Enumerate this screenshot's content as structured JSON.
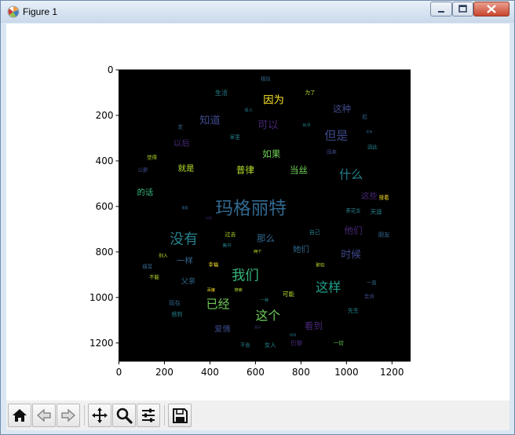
{
  "window": {
    "title": "Figure 1"
  },
  "toolbar": {
    "buttons": [
      "home-icon",
      "back-icon",
      "forward-icon",
      "pan-icon",
      "zoom-icon",
      "configure-subplots-icon",
      "save-icon"
    ]
  },
  "chart_data": {
    "type": "image",
    "description_free": true,
    "x_ticks": [
      "0",
      "200",
      "400",
      "600",
      "800",
      "1000",
      "1200"
    ],
    "y_ticks": [
      "0",
      "200",
      "400",
      "600",
      "800",
      "1000",
      "1200"
    ],
    "xlim": [
      0,
      1280
    ],
    "ylim": [
      1280,
      0
    ],
    "background": "#000000",
    "words": [
      {
        "text": "玛格丽特",
        "x": 580,
        "y": 610,
        "size": 78,
        "color": "#31688e"
      },
      {
        "text": "没有",
        "x": 285,
        "y": 745,
        "size": 62,
        "color": "#26828e"
      },
      {
        "text": "我们",
        "x": 555,
        "y": 905,
        "size": 60,
        "color": "#35b779"
      },
      {
        "text": "这样",
        "x": 920,
        "y": 955,
        "size": 56,
        "color": "#1f9e89"
      },
      {
        "text": "这个",
        "x": 655,
        "y": 1080,
        "size": 54,
        "color": "#6ece58"
      },
      {
        "text": "已经",
        "x": 435,
        "y": 1030,
        "size": 52,
        "color": "#6ece58"
      },
      {
        "text": "但是",
        "x": 955,
        "y": 290,
        "size": 52,
        "color": "#3e4989"
      },
      {
        "text": "什么",
        "x": 1020,
        "y": 460,
        "size": 52,
        "color": "#26828e"
      },
      {
        "text": "因为",
        "x": 680,
        "y": 135,
        "size": 46,
        "color": "#fde725"
      },
      {
        "text": "知道",
        "x": 400,
        "y": 225,
        "size": 46,
        "color": "#3e4989"
      },
      {
        "text": "可以",
        "x": 655,
        "y": 245,
        "size": 46,
        "color": "#482878"
      },
      {
        "text": "这种",
        "x": 980,
        "y": 170,
        "size": 40,
        "color": "#3e4989"
      },
      {
        "text": "如果",
        "x": 670,
        "y": 370,
        "size": 40,
        "color": "#6ece58"
      },
      {
        "text": "普律",
        "x": 555,
        "y": 440,
        "size": 40,
        "color": "#b5de2b"
      },
      {
        "text": "当丝",
        "x": 790,
        "y": 440,
        "size": 40,
        "color": "#6ece58"
      },
      {
        "text": "就是",
        "x": 295,
        "y": 435,
        "size": 36,
        "color": "#b5de2b"
      },
      {
        "text": "以后",
        "x": 275,
        "y": 325,
        "size": 36,
        "color": "#482878"
      },
      {
        "text": "那么",
        "x": 645,
        "y": 740,
        "size": 40,
        "color": "#31688e"
      },
      {
        "text": "他们",
        "x": 1030,
        "y": 705,
        "size": 40,
        "color": "#482878"
      },
      {
        "text": "这些",
        "x": 1100,
        "y": 555,
        "size": 36,
        "color": "#482878"
      },
      {
        "text": "时候",
        "x": 1020,
        "y": 815,
        "size": 44,
        "color": "#3e4989"
      },
      {
        "text": "她们",
        "x": 800,
        "y": 790,
        "size": 36,
        "color": "#31688e"
      },
      {
        "text": "看到",
        "x": 855,
        "y": 1125,
        "size": 40,
        "color": "#482878"
      },
      {
        "text": "爱情",
        "x": 455,
        "y": 1140,
        "size": 36,
        "color": "#3e4989"
      },
      {
        "text": "一样",
        "x": 290,
        "y": 840,
        "size": 36,
        "color": "#31688e"
      },
      {
        "text": "父亲",
        "x": 305,
        "y": 930,
        "size": 32,
        "color": "#31688e"
      },
      {
        "text": "的话",
        "x": 115,
        "y": 540,
        "size": 36,
        "color": "#35b779"
      },
      {
        "text": "家里",
        "x": 510,
        "y": 295,
        "size": 22,
        "color": "#26828e"
      },
      {
        "text": "生活",
        "x": 450,
        "y": 100,
        "size": 28,
        "color": "#26828e"
      },
      {
        "text": "茶花女",
        "x": 1030,
        "y": 620,
        "size": 22,
        "color": "#26828e"
      },
      {
        "text": "天涯",
        "x": 1130,
        "y": 625,
        "size": 26,
        "color": "#26828e"
      },
      {
        "text": "朋友",
        "x": 1165,
        "y": 725,
        "size": 26,
        "color": "#31688e"
      },
      {
        "text": "过去",
        "x": 490,
        "y": 725,
        "size": 24,
        "color": "#b5de2b"
      },
      {
        "text": "自己",
        "x": 860,
        "y": 715,
        "size": 24,
        "color": "#26828e"
      },
      {
        "text": "可能",
        "x": 745,
        "y": 985,
        "size": 26,
        "color": "#b5de2b"
      },
      {
        "text": "现在",
        "x": 245,
        "y": 1025,
        "size": 26,
        "color": "#31688e"
      },
      {
        "text": "感到",
        "x": 255,
        "y": 1075,
        "size": 24,
        "color": "#26828e"
      },
      {
        "text": "女人",
        "x": 665,
        "y": 1210,
        "size": 26,
        "color": "#26828e"
      },
      {
        "text": "巴黎",
        "x": 780,
        "y": 1200,
        "size": 26,
        "color": "#482878"
      },
      {
        "text": "先生",
        "x": 1030,
        "y": 1060,
        "size": 24,
        "color": "#26828e"
      },
      {
        "text": "告诉",
        "x": 1100,
        "y": 995,
        "size": 22,
        "color": "#3e4989"
      },
      {
        "text": "一直",
        "x": 1110,
        "y": 935,
        "size": 22,
        "color": "#31688e"
      },
      {
        "text": "不会",
        "x": 555,
        "y": 1210,
        "size": 22,
        "color": "#26828e"
      },
      {
        "text": "百度",
        "x": 405,
        "y": 970,
        "size": 18,
        "color": "#fde725"
      },
      {
        "text": "搜索",
        "x": 525,
        "y": 970,
        "size": 18,
        "color": "#b5de2b"
      },
      {
        "text": "幸福",
        "x": 415,
        "y": 855,
        "size": 22,
        "color": "#fde725"
      },
      {
        "text": "不能",
        "x": 155,
        "y": 910,
        "size": 22,
        "color": "#b5de2b"
      },
      {
        "text": "痛苦",
        "x": 125,
        "y": 865,
        "size": 22,
        "color": "#31688e"
      },
      {
        "text": "别人",
        "x": 195,
        "y": 820,
        "size": 20,
        "color": "#b5de2b"
      },
      {
        "text": "离开",
        "x": 475,
        "y": 775,
        "size": 20,
        "color": "#26828e"
      },
      {
        "text": "两个",
        "x": 610,
        "y": 800,
        "size": 18,
        "color": "#b5de2b"
      },
      {
        "text": "那些",
        "x": 885,
        "y": 860,
        "size": 20,
        "color": "#b5de2b"
      },
      {
        "text": "公爵",
        "x": 105,
        "y": 440,
        "size": 22,
        "color": "#3e4989"
      },
      {
        "text": "觉得",
        "x": 145,
        "y": 385,
        "size": 22,
        "color": "#b5de2b"
      },
      {
        "text": "相信",
        "x": 645,
        "y": 40,
        "size": 22,
        "color": "#31688e"
      },
      {
        "text": "为了",
        "x": 840,
        "y": 100,
        "size": 22,
        "color": "#b5de2b"
      },
      {
        "text": "因此",
        "x": 1115,
        "y": 340,
        "size": 22,
        "color": "#26828e"
      },
      {
        "text": "回来",
        "x": 935,
        "y": 360,
        "size": 22,
        "color": "#3e4989"
      },
      {
        "text": "情人",
        "x": 570,
        "y": 180,
        "size": 18,
        "color": "#26828e"
      },
      {
        "text": "似乎",
        "x": 825,
        "y": 245,
        "size": 18,
        "color": "#26828e"
      },
      {
        "text": "一切",
        "x": 965,
        "y": 1200,
        "size": 22,
        "color": "#6ece58"
      },
      {
        "text": "接着",
        "x": 1165,
        "y": 560,
        "size": 22,
        "color": "#fde725"
      },
      {
        "text": "一种",
        "x": 640,
        "y": 1015,
        "size": 18,
        "color": "#26828e"
      },
      {
        "text": "起",
        "x": 1080,
        "y": 205,
        "size": 22,
        "color": "#31688e"
      },
      {
        "text": "定",
        "x": 270,
        "y": 250,
        "size": 22,
        "color": "#31688e"
      },
      {
        "text": "以前",
        "x": 395,
        "y": 650,
        "size": 14,
        "color": "#482878"
      },
      {
        "text": "需要",
        "x": 290,
        "y": 605,
        "size": 14,
        "color": "#31688e"
      },
      {
        "text": "显示",
        "x": 610,
        "y": 1130,
        "size": 14,
        "color": "#3e4989"
      },
      {
        "text": "时间",
        "x": 765,
        "y": 1165,
        "size": 14,
        "color": "#26828e"
      },
      {
        "text": "还有",
        "x": 1100,
        "y": 270,
        "size": 14,
        "color": "#31688e"
      }
    ]
  }
}
